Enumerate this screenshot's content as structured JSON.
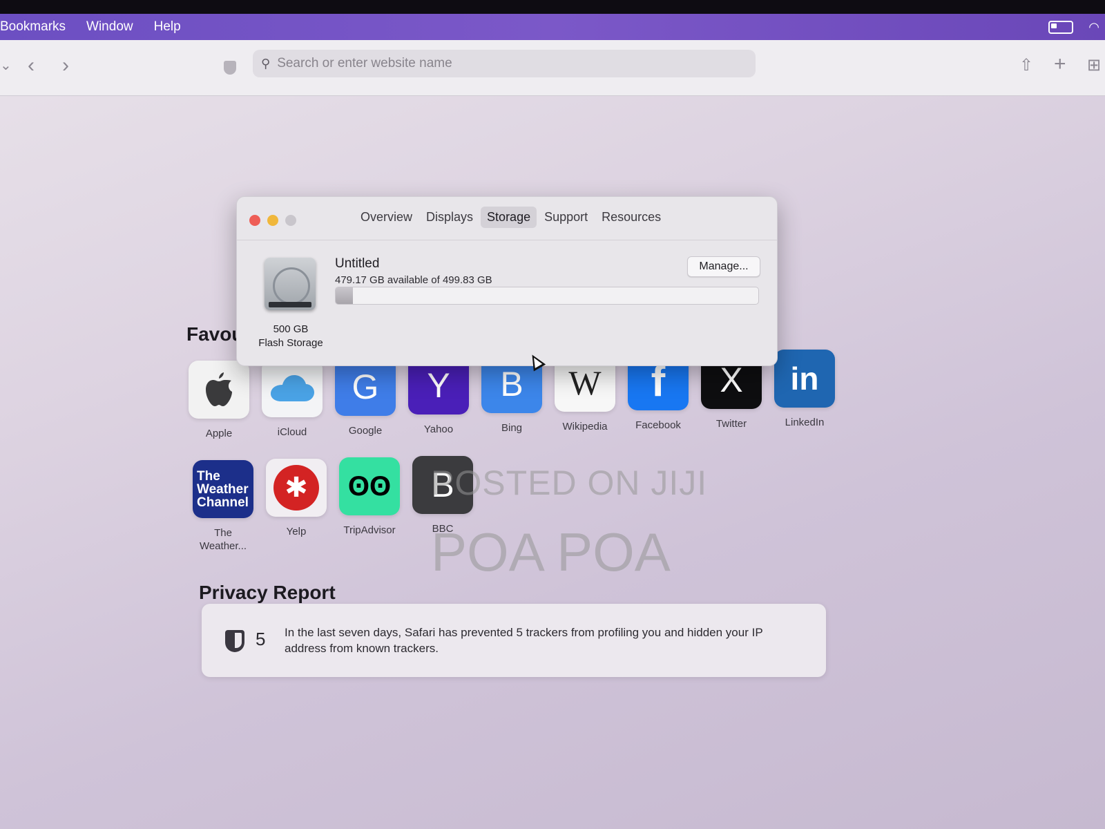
{
  "menubar": {
    "items": [
      "Bookmarks",
      "Window",
      "Help"
    ]
  },
  "toolbar": {
    "search_placeholder": "Search or enter website name"
  },
  "favourites": {
    "title": "Favou",
    "row1": [
      {
        "label": "Apple",
        "glyph": "",
        "color": "#f2f2f2",
        "fg": "#444"
      },
      {
        "label": "iCloud",
        "glyph": "☁",
        "color": "#f3f4f6",
        "fg": "#4aa3e6"
      },
      {
        "label": "Google",
        "glyph": "G",
        "color": "#3f7de8",
        "fg": "#ffffff"
      },
      {
        "label": "Yahoo",
        "glyph": "Y",
        "color": "#4a1fb8",
        "fg": "#ffffff"
      },
      {
        "label": "Bing",
        "glyph": "B",
        "color": "#3c86ea",
        "fg": "#ffffff"
      },
      {
        "label": "Wikipedia",
        "glyph": "W",
        "color": "#f7f7f7",
        "fg": "#222222"
      },
      {
        "label": "Facebook",
        "glyph": "f",
        "color": "#1877f2",
        "fg": "#ffffff"
      },
      {
        "label": "Twitter",
        "glyph": "X",
        "color": "#0e0e10",
        "fg": "#ffffff"
      },
      {
        "label": "LinkedIn",
        "glyph": "in",
        "color": "#1f66b1",
        "fg": "#ffffff"
      }
    ],
    "row2": [
      {
        "label": "The Weather...",
        "glyph": "The Weather Channel",
        "color": "#1c2f8a",
        "fg": "#ffffff"
      },
      {
        "label": "Yelp",
        "glyph": "✱",
        "color": "#f1eef2",
        "fg": "#d32323"
      },
      {
        "label": "TripAdvisor",
        "glyph": "ʘʘ",
        "color": "#34e0a1",
        "fg": "#000000"
      },
      {
        "label": "BBC",
        "glyph": "B",
        "color": "#3b3b3e",
        "fg": "#ffffff"
      }
    ]
  },
  "privacy": {
    "title": "Privacy Report",
    "count": "5",
    "text": "In the last seven days, Safari has prevented 5 trackers from profiling you and hidden your IP address from known trackers."
  },
  "watermark": {
    "line1": "POSTED ON JIJI",
    "line2": "POA POA"
  },
  "about_window": {
    "tabs": [
      "Overview",
      "Displays",
      "Storage",
      "Support",
      "Resources"
    ],
    "active_tab": "Storage",
    "drive_capacity": "500 GB",
    "drive_type": "Flash Storage",
    "volume_name": "Untitled",
    "volume_available": "479.17 GB available of 499.83 GB",
    "used_fraction": 0.041,
    "manage_label": "Manage..."
  }
}
